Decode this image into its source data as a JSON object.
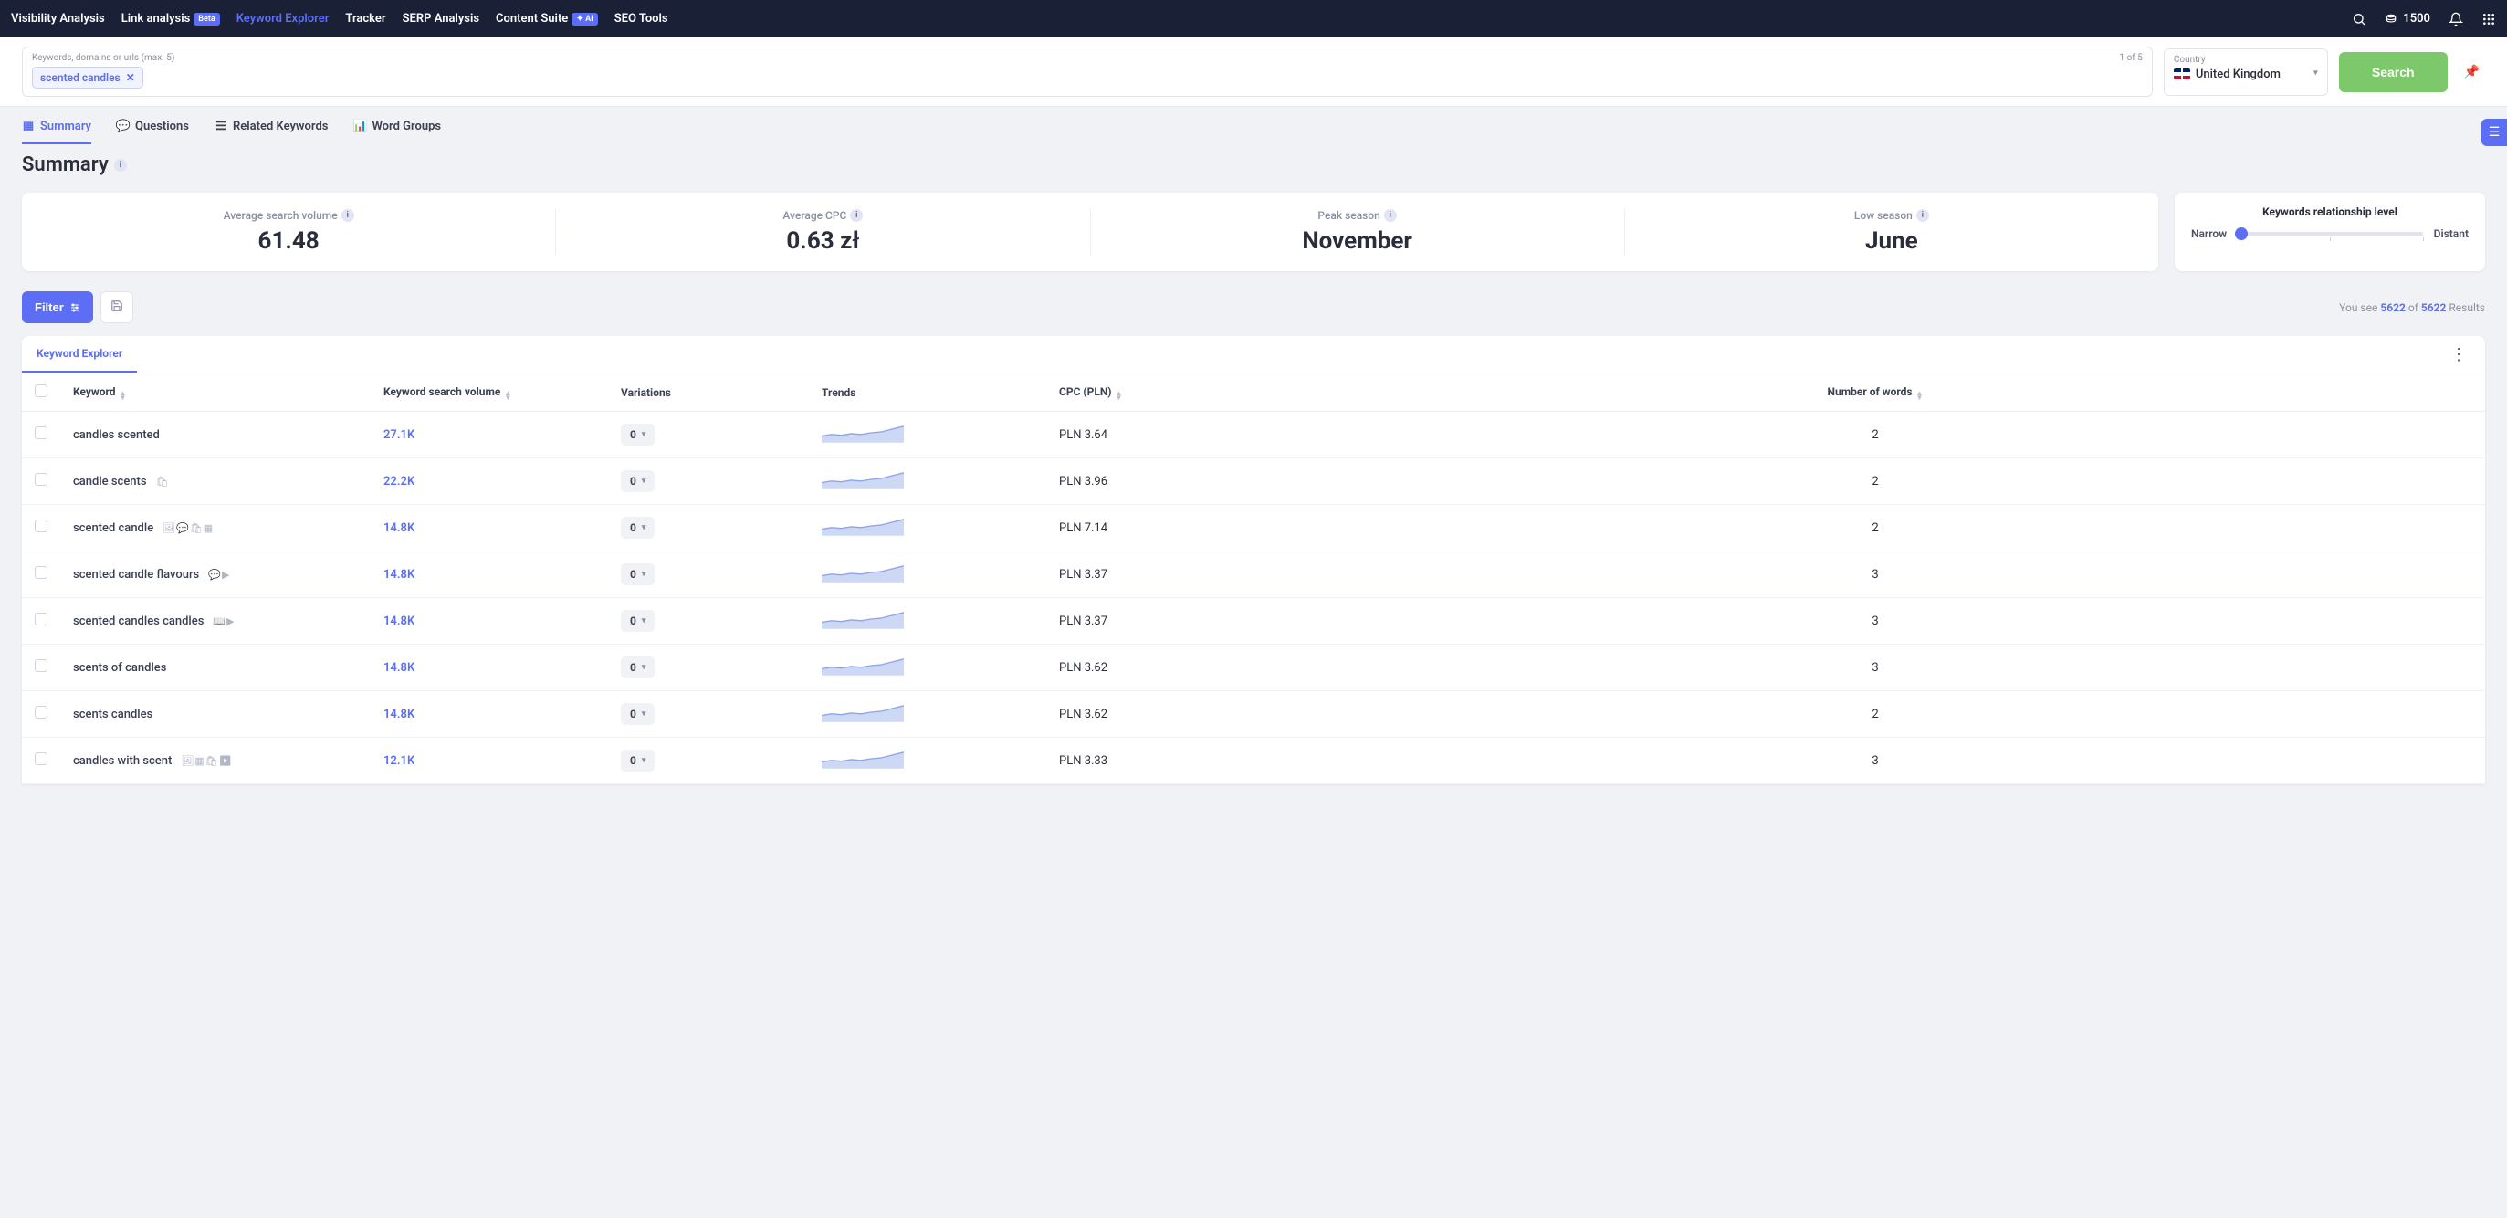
{
  "nav": {
    "items": [
      {
        "label": "Visibility Analysis",
        "active": false
      },
      {
        "label": "Link analysis",
        "badge": "Beta",
        "active": false
      },
      {
        "label": "Keyword Explorer",
        "active": true
      },
      {
        "label": "Tracker",
        "active": false
      },
      {
        "label": "SERP Analysis",
        "active": false
      },
      {
        "label": "Content Suite",
        "badge": "✦ AI",
        "active": false
      },
      {
        "label": "SEO Tools",
        "active": false
      }
    ],
    "credits": "1500"
  },
  "search": {
    "label": "Keywords, domains or urls (max. 5)",
    "chip": "scented candles",
    "counter": "1 of 5",
    "country_label": "Country",
    "country": "United Kingdom",
    "button": "Search"
  },
  "tabs": [
    "Summary",
    "Questions",
    "Related Keywords",
    "Word Groups"
  ],
  "page_title": "Summary",
  "metrics": [
    {
      "label": "Average search volume",
      "value": "61.48"
    },
    {
      "label": "Average CPC",
      "value": "0.63 zł"
    },
    {
      "label": "Peak season",
      "value": "November"
    },
    {
      "label": "Low season",
      "value": "June"
    }
  ],
  "relationship": {
    "title": "Keywords relationship level",
    "left": "Narrow",
    "right": "Distant"
  },
  "filter": {
    "button": "Filter",
    "results_prefix": "You see",
    "results_shown": "5622",
    "results_of": "of",
    "results_total": "5622",
    "results_suffix": "Results"
  },
  "table": {
    "tab": "Keyword Explorer",
    "headers": [
      "Keyword",
      "Keyword search volume",
      "Variations",
      "Trends",
      "CPC (PLN)",
      "Number of words"
    ],
    "rows": [
      {
        "keyword": "candles scented",
        "icons": "",
        "volume": "27.1K",
        "variations": "0",
        "cpc": "PLN 3.64",
        "words": "2"
      },
      {
        "keyword": "candle scents",
        "icons": "🛍",
        "volume": "22.2K",
        "variations": "0",
        "cpc": "PLN 3.96",
        "words": "2"
      },
      {
        "keyword": "scented candle",
        "icons": "🖼💬🛍▦",
        "volume": "14.8K",
        "variations": "0",
        "cpc": "PLN 7.14",
        "words": "2"
      },
      {
        "keyword": "scented candle flavours",
        "icons": "💬▶",
        "volume": "14.8K",
        "variations": "0",
        "cpc": "PLN 3.37",
        "words": "3"
      },
      {
        "keyword": "scented candles candles",
        "icons": "📖▶",
        "volume": "14.8K",
        "variations": "0",
        "cpc": "PLN 3.37",
        "words": "3"
      },
      {
        "keyword": "scents of candles",
        "icons": "",
        "volume": "14.8K",
        "variations": "0",
        "cpc": "PLN 3.62",
        "words": "3"
      },
      {
        "keyword": "scents candles",
        "icons": "",
        "volume": "14.8K",
        "variations": "0",
        "cpc": "PLN 3.62",
        "words": "2"
      },
      {
        "keyword": "candles with scent",
        "icons": "🖼▦🛍▶",
        "volume": "12.1K",
        "variations": "0",
        "cpc": "PLN 3.33",
        "words": "3"
      }
    ]
  }
}
